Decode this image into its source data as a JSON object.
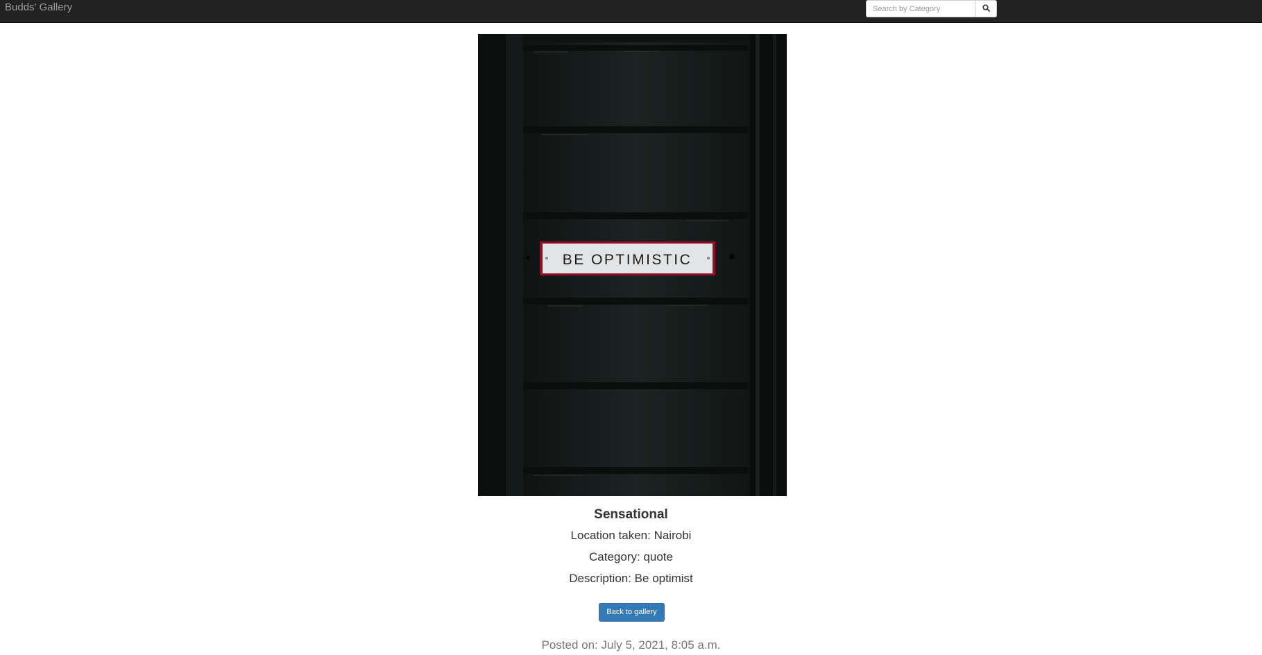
{
  "navbar": {
    "brand": "Budds' Gallery",
    "search": {
      "placeholder": "Search by Category",
      "value": "",
      "button_icon": "search-icon"
    }
  },
  "photo": {
    "sign_text": "BE OPTIMISTIC"
  },
  "image_details": {
    "title": "Sensational",
    "location": "Location taken: Nairobi",
    "category": "Category: quote",
    "description": "Description: Be optimist",
    "back_button_label": "Back to gallery",
    "posted": "Posted on: July 5, 2021, 8:05 a.m."
  },
  "colors": {
    "navbar_bg": "#222222",
    "brand_text": "#9d9d9d",
    "button_primary": "#337ab7",
    "muted_text": "#777777"
  }
}
